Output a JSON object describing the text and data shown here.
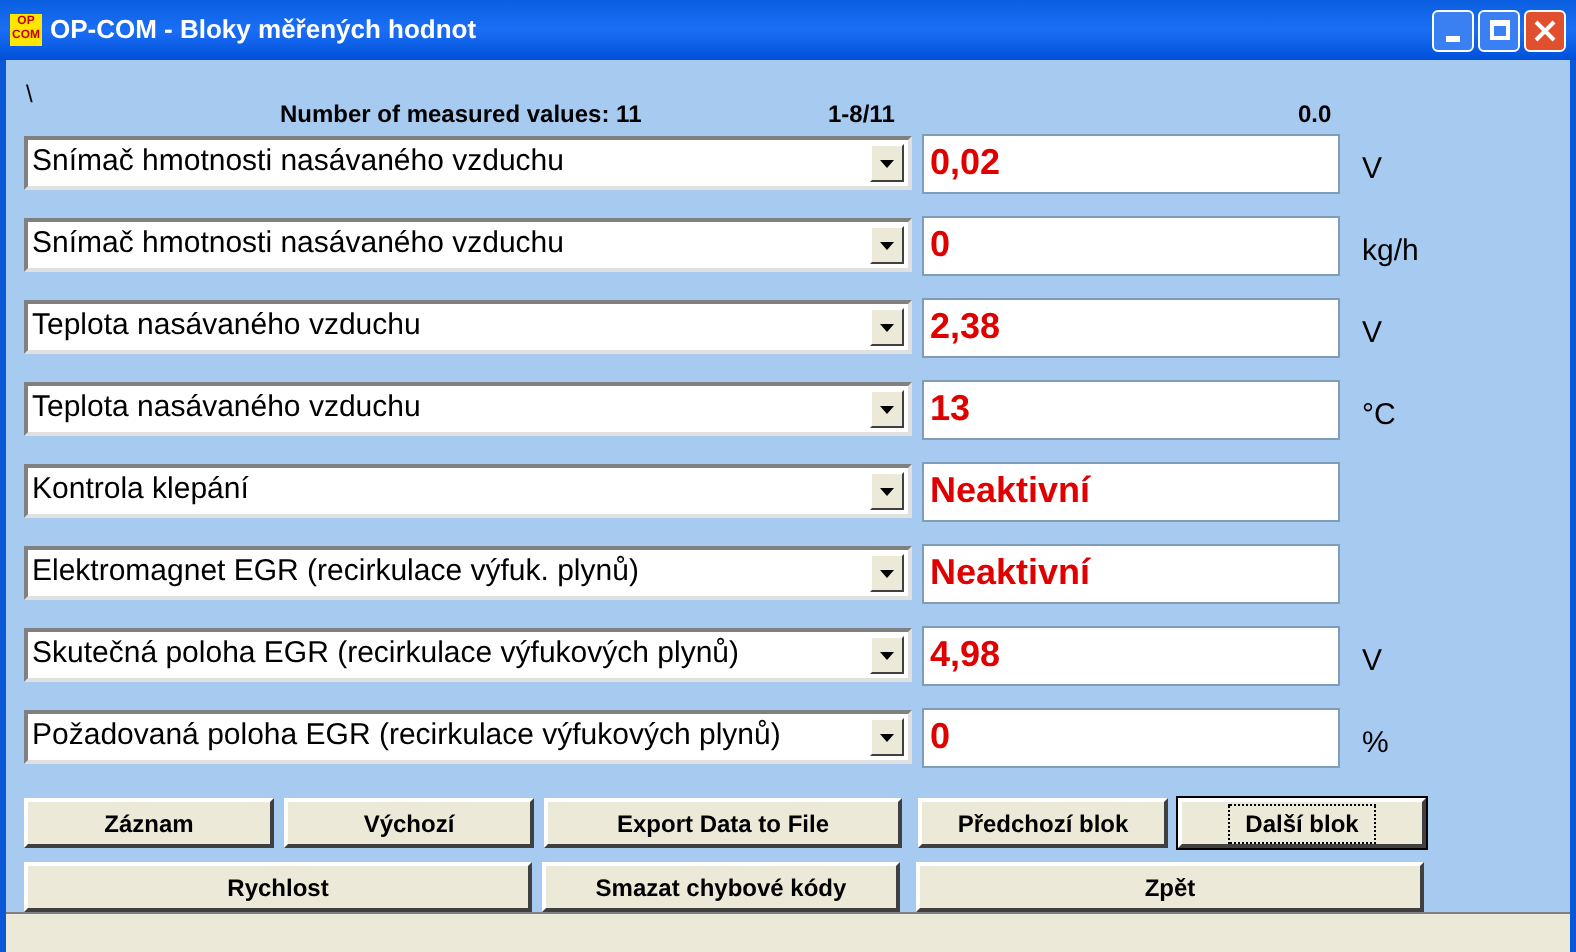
{
  "window": {
    "title": "OP-COM - Bloky měřených hodnot",
    "icon_text": [
      "OP",
      "COM"
    ]
  },
  "header": {
    "path": "\\",
    "count": "Number of measured values: 11",
    "range": "1-8/11",
    "time": "0.0"
  },
  "rows": [
    {
      "name": "Snímač hmotnosti nasávaného vzduchu",
      "value": "0,02",
      "unit": "V"
    },
    {
      "name": "Snímač hmotnosti nasávaného vzduchu",
      "value": "0",
      "unit": "kg/h"
    },
    {
      "name": "Teplota nasávaného vzduchu",
      "value": "2,38",
      "unit": "V"
    },
    {
      "name": "Teplota nasávaného vzduchu",
      "value": "13",
      "unit": "°C"
    },
    {
      "name": "Kontrola klepání",
      "value": "Neaktivní"
    },
    {
      "name": "Elektromagnet EGR (recirkulace výfuk. plynů)",
      "value": "Neaktivní"
    },
    {
      "name": "Skutečná poloha EGR (recirkulace výfukových plynů)",
      "value": "4,98",
      "unit": "V"
    },
    {
      "name": "Požadovaná poloha EGR (recirkulace výfukových plynů)",
      "value": "0",
      "unit": "%"
    }
  ],
  "buttons_row_1": [
    {
      "label": "Záznam",
      "focused": false
    },
    {
      "label": "Výchozí",
      "focused": false
    },
    {
      "label": "Export Data to File",
      "focused": false
    },
    {
      "label": "Předchozí blok",
      "focused": false
    },
    {
      "label": "Další blok",
      "focused": true
    }
  ],
  "buttons_row_2": [
    {
      "label": "Rychlost",
      "focused": false
    },
    {
      "label": "Smazat chybové kódy",
      "focused": false
    },
    {
      "label": "Zpět",
      "focused": false
    }
  ]
}
